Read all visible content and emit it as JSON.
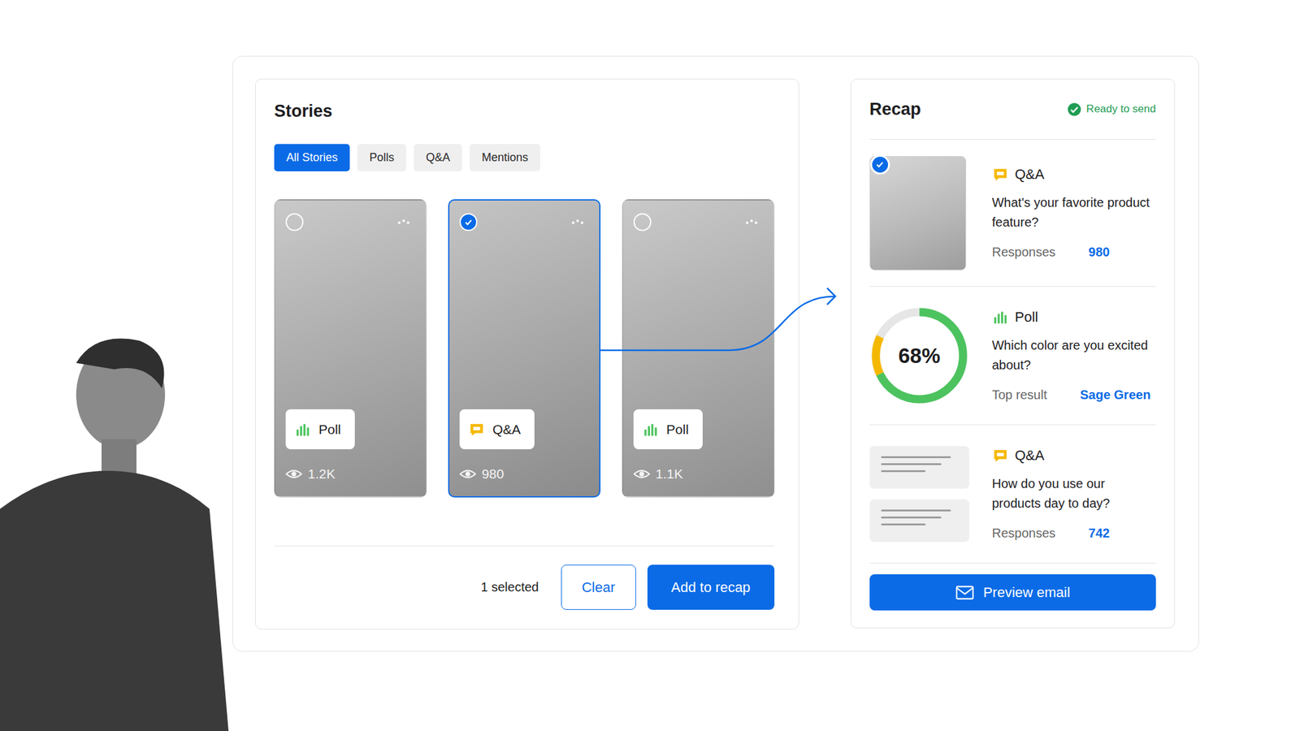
{
  "stories": {
    "title": "Stories",
    "filters": [
      {
        "label": "All Stories",
        "selected": true
      },
      {
        "label": "Polls",
        "selected": false
      },
      {
        "label": "Q&A",
        "selected": false
      },
      {
        "label": "Mentions",
        "selected": false
      }
    ],
    "cards": [
      {
        "kind": "poll",
        "label": "Poll",
        "views": "1.2K",
        "selected": false
      },
      {
        "kind": "qa",
        "label": "Q&A",
        "views": "980",
        "selected": true
      },
      {
        "kind": "poll",
        "label": "Poll",
        "views": "1.1K",
        "selected": false
      }
    ],
    "footer": {
      "count": "1 selected",
      "buttons": [
        {
          "label": "Clear",
          "kind": "secondary"
        },
        {
          "label": "Add to recap",
          "kind": "primary"
        }
      ]
    }
  },
  "recap": {
    "title": "Recap",
    "status": "Ready to send",
    "items": [
      {
        "kind": "qa-photo",
        "label": "Q&A",
        "question": "What's your favorite product feature?",
        "meta_label": "Responses",
        "meta_value": "980",
        "selected": true
      },
      {
        "kind": "poll",
        "label": "Poll",
        "question": "Which color are you excited about?",
        "meta_label": "Top result",
        "meta_value": "Sage Green",
        "reading": "68%",
        "segments": [
          {
            "level": 0.68,
            "color": "#4cc35e"
          },
          {
            "level": 0.14,
            "color": "#f5b800"
          }
        ]
      },
      {
        "kind": "qa-text",
        "label": "Q&A",
        "question": "How do you use our products day to day?",
        "meta_label": "Responses",
        "meta_value": "742"
      }
    ],
    "button": "Preview email"
  }
}
